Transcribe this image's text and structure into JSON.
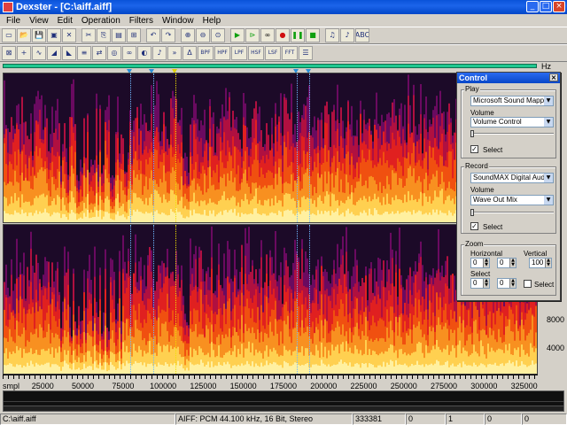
{
  "window": {
    "title": "Dexster - [C:\\aiff.aiff]",
    "min": "_",
    "max": "□",
    "close": "×"
  },
  "menu": [
    "File",
    "View",
    "Edit",
    "Operation",
    "Filters",
    "Window",
    "Help"
  ],
  "toolbar1": [
    "new-icon",
    "open-icon",
    "save-icon",
    "save-as-icon",
    "properties-icon",
    "sep",
    "cut-icon",
    "copy-icon",
    "paste-icon",
    "paste-mix-icon",
    "sep",
    "undo-icon",
    "redo-icon",
    "sep",
    "zoom-in-icon",
    "zoom-out-icon",
    "zoom-fit-icon",
    "sep",
    "play-icon",
    "play-selection-icon",
    "loop-icon",
    "record-icon",
    "pause-icon",
    "stop-icon",
    "sep",
    "volume-icon",
    "mute-icon",
    "abc-icon"
  ],
  "toolbar2": [
    {
      "icon": "snap-icon",
      "text": "⊠"
    },
    {
      "icon": "cursor-icon",
      "text": "+"
    },
    {
      "icon": "waveform-icon",
      "text": "∿"
    },
    {
      "icon": "fade-in-icon",
      "text": "◢"
    },
    {
      "icon": "fade-out-icon",
      "text": "◣"
    },
    {
      "icon": "normalize-icon",
      "text": "≡"
    },
    {
      "icon": "reverse-icon",
      "text": "⇄"
    },
    {
      "icon": "echo-icon",
      "text": "◎"
    },
    {
      "icon": "chorus-icon",
      "text": "∞"
    },
    {
      "icon": "flanger-icon",
      "text": "◐"
    },
    {
      "icon": "pitch-icon",
      "text": "♪"
    },
    {
      "icon": "speed-icon",
      "text": "»"
    },
    {
      "icon": "delay-icon",
      "text": "Δ"
    },
    {
      "icon": "bpf-icon",
      "text": "BPF"
    },
    {
      "icon": "hpf-icon",
      "text": "HPF"
    },
    {
      "icon": "lpf-icon",
      "text": "LPF"
    },
    {
      "icon": "hsf-icon",
      "text": "HSF"
    },
    {
      "icon": "lsf-icon",
      "text": "LSF"
    },
    {
      "icon": "fft-icon",
      "text": "FFT"
    },
    {
      "icon": "list-icon",
      "text": "☰"
    }
  ],
  "ruler": {
    "unit": "Hz"
  },
  "y_axis": [
    "8000",
    "4000"
  ],
  "x_axis": {
    "unit": "smpl",
    "ticks": [
      "25000",
      "50000",
      "75000",
      "100000",
      "125000",
      "150000",
      "175000",
      "200000",
      "225000",
      "250000",
      "275000",
      "300000",
      "325000"
    ]
  },
  "status": {
    "file": "C:\\aiff.aiff",
    "format": "AIFF: PCM 44.100 kHz, 16 Bit, Stereo",
    "samples": "333381",
    "v1": "0",
    "v2": "1",
    "v3": "0",
    "v4": "0"
  },
  "control": {
    "title": "Control",
    "play": {
      "label": "Play",
      "device": "Microsoft Sound Mapper",
      "volume_label": "Volume",
      "volume_source": "Volume Control",
      "select": "Select",
      "level": 0.0
    },
    "record": {
      "label": "Record",
      "device": "SoundMAX Digital Audio",
      "volume_label": "Volume",
      "volume_source": "Wave Out Mix",
      "select": "Select",
      "level": 0.0
    },
    "zoom": {
      "label": "Zoom",
      "horizontal": "Horizontal",
      "vertical": "Vertical",
      "h1": "0",
      "h2": "0",
      "v": "100",
      "select_label": "Select",
      "s1": "0",
      "s2": "0",
      "select_check": "Select"
    }
  }
}
